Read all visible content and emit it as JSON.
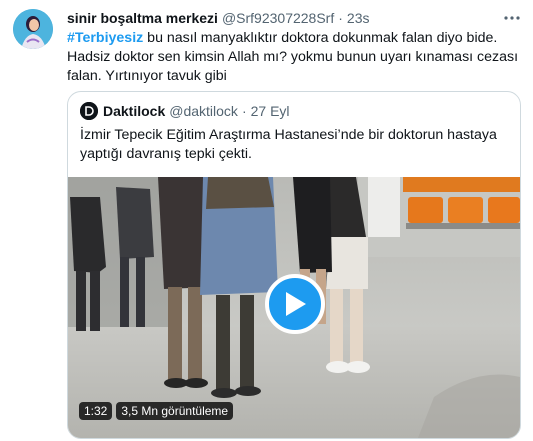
{
  "tweet": {
    "author_name": "sinir boşaltma merkezi",
    "author_handle": "@Srf92307228Srf",
    "separator": "·",
    "time": "23s",
    "more_icon": "more-dots-icon",
    "hashtag": "#Terbiyesiz",
    "text": " bu nasıl manyaklıktır doktora dokunmak falan diyo bide. Hadsiz doktor sen kimsin Allah mı? yokmu bunun uyarı kınaması cezası falan. Yırtınıyor tavuk gibi"
  },
  "quote": {
    "author_name": "Daktilock",
    "author_handle": "@daktilock",
    "separator": "·",
    "date": "27 Eyl",
    "text": "İzmir Tepecik Eğitim Araştırma Hastanesi’nde bir doktorun hastaya yaptığı davranış tepki çekti.",
    "video": {
      "duration": "1:32",
      "views": "3,5 Mn görüntüleme",
      "play_icon": "play-icon"
    }
  },
  "colors": {
    "accent": "#1d9bf0",
    "text": "#0f1419",
    "muted": "#536471",
    "border": "#cfd9de"
  }
}
